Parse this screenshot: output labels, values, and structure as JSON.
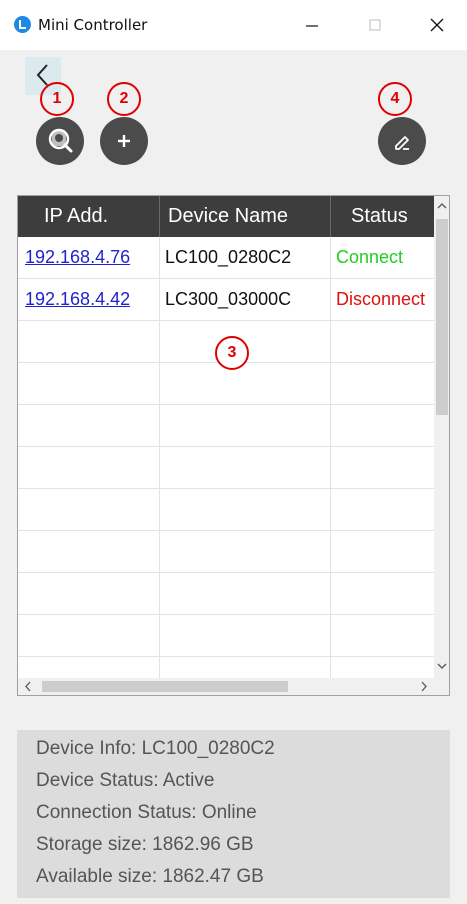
{
  "window": {
    "title": "Mini Controller",
    "minimize_label": "—",
    "maximize_label": "☐",
    "close_label": "✕"
  },
  "badges": [
    "1",
    "2",
    "3",
    "4"
  ],
  "table": {
    "headers": [
      "IP Add.",
      "Device Name",
      "Status"
    ],
    "rows": [
      {
        "ip": "192.168.4.76",
        "name": "LC100_0280C2",
        "status": "Connect",
        "status_color": "#22cc22"
      },
      {
        "ip": "192.168.4.42",
        "name": "LC300_03000C",
        "status": "Disconnect",
        "status_color": "#e01010"
      }
    ],
    "empty_rows": 10
  },
  "device_info": {
    "info": "Device Info: LC100_0280C2",
    "device_status": "Device Status: Active",
    "connection_status": "Connection Status: Online",
    "storage_size": "Storage size: 1862.96 GB",
    "available_size": "Available size: 1862.47 GB"
  },
  "icons": {
    "back": "chevron-left-icon",
    "search_device": "search-device-icon",
    "add": "plus-icon",
    "edit": "pencil-icon"
  },
  "colors": {
    "header_bg": "#3d3d3d",
    "accent": "#1e88e5",
    "badge": "#e00000",
    "tool_button": "#4b4b4b"
  }
}
